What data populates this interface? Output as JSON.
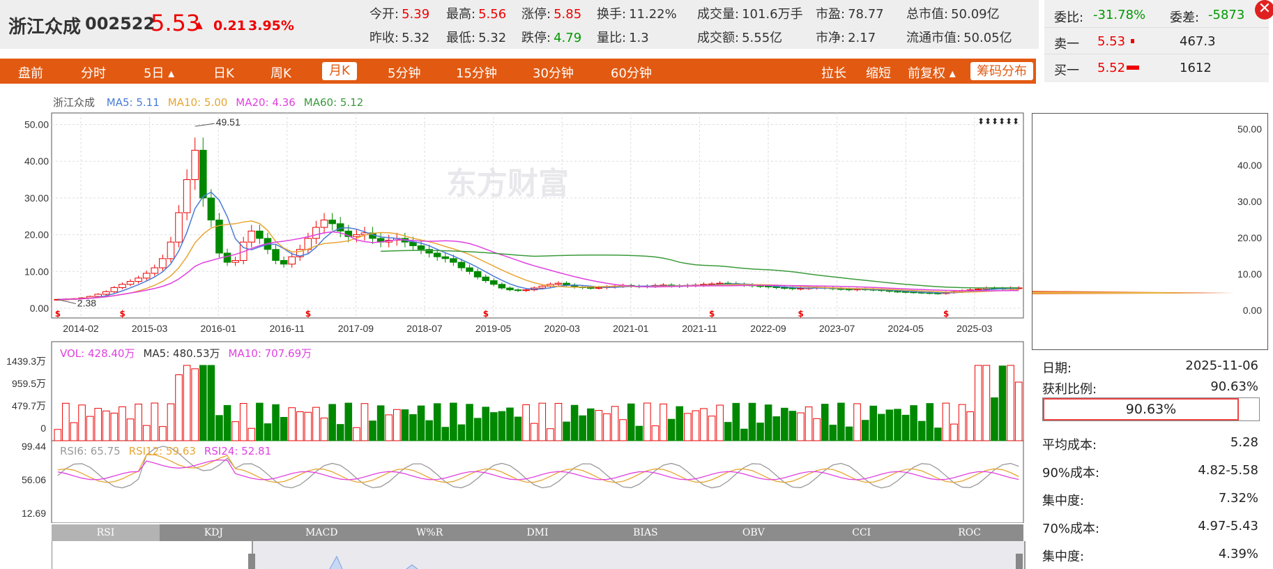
{
  "header": {
    "name": "浙江众成",
    "code": "002522",
    "price": "5.53",
    "arrow": "▲",
    "change": "0.21",
    "change_pct": "3.95%",
    "quote": [
      {
        "label": "今开:",
        "value": "5.39",
        "color": "red"
      },
      {
        "label": "最高:",
        "value": "5.56",
        "color": "red"
      },
      {
        "label": "涨停:",
        "value": "5.85",
        "color": "red"
      },
      {
        "label": "换手:",
        "value": "11.22%",
        "color": "black"
      },
      {
        "label": "成交量:",
        "value": "101.6万手",
        "color": "black"
      },
      {
        "label": "市盈:",
        "value": "78.77",
        "color": "black"
      },
      {
        "label": "总市值:",
        "value": "50.09亿",
        "color": "black"
      },
      {
        "label": "昨收:",
        "value": "5.32",
        "color": "black"
      },
      {
        "label": "最低:",
        "value": "5.32",
        "color": "black"
      },
      {
        "label": "跌停:",
        "value": "4.79",
        "color": "green"
      },
      {
        "label": "量比:",
        "value": "1.3",
        "color": "black"
      },
      {
        "label": "成交额:",
        "value": "5.55亿",
        "color": "black"
      },
      {
        "label": "市净:",
        "value": "2.17",
        "color": "black"
      },
      {
        "label": "流通市值:",
        "value": "50.05亿",
        "color": "black"
      }
    ]
  },
  "order_book": {
    "weibi_label": "委比:",
    "weibi_value": "-31.78%",
    "weicha_label": "委差:",
    "weicha_value": "-5873",
    "ask_label": "卖一",
    "ask_price": "5.53",
    "ask_volume": "467.3",
    "bid_label": "买一",
    "bid_price": "5.52",
    "bid_volume": "1612"
  },
  "toolbar": {
    "tabs": [
      "盘前",
      "分时",
      "5日 ▴",
      "日K",
      "周K",
      "月K",
      "5分钟",
      "15分钟",
      "30分钟",
      "60分钟"
    ],
    "active_tab": "月K",
    "right": [
      "拉长",
      "缩短",
      "前复权 ▴",
      "筹码分布"
    ]
  },
  "chart_data": {
    "type": "candlestick",
    "title": "浙江众成",
    "watermark": "东方财富",
    "period": "monthly",
    "ma_legend": [
      {
        "label": "MA5: 5.11",
        "color": "#4a7bd6"
      },
      {
        "label": "MA10: 5.00",
        "color": "#e8a532"
      },
      {
        "label": "MA20: 4.36",
        "color": "#e040e0"
      },
      {
        "label": "MA60: 5.12",
        "color": "#3a9a3a"
      }
    ],
    "price_ticks": [
      "50.00",
      "40.00",
      "30.00",
      "20.00",
      "10.00",
      "0.00"
    ],
    "ylim": [
      0,
      52
    ],
    "x_ticks": [
      "2014-02",
      "2015-03",
      "2016-01",
      "2016-11",
      "2017-09",
      "2018-07",
      "2019-05",
      "2020-03",
      "2021-01",
      "2021-11",
      "2022-09",
      "2023-07",
      "2024-05",
      "2025-03"
    ],
    "annotations": {
      "high": "49.51",
      "low": "2.38"
    },
    "close_series": [
      2.4,
      2.5,
      2.6,
      2.8,
      3.2,
      3.8,
      4.5,
      5.6,
      6.5,
      7.3,
      8.2,
      9.5,
      11,
      13.5,
      18,
      26,
      35,
      43,
      30,
      24,
      15,
      12.5,
      13,
      18,
      21,
      19,
      16,
      13,
      12,
      14,
      16,
      19,
      22,
      24,
      23,
      21,
      19.5,
      20,
      20.5,
      19,
      18,
      18.5,
      19,
      18,
      17,
      16,
      15,
      14,
      13.5,
      12.5,
      11,
      10,
      8.5,
      7.5,
      6.5,
      5.5,
      5,
      4.8,
      5,
      5.5,
      6,
      6.5,
      6.8,
      6.3,
      5.8,
      5.6,
      5.5,
      5.6,
      5.8,
      6,
      6.2,
      6,
      5.9,
      6,
      6.2,
      6.3,
      6.1,
      6,
      6.2,
      6.3,
      6.5,
      6.6,
      6.8,
      6.7,
      6.5,
      6.3,
      6.1,
      6,
      5.8,
      5.6,
      5.5,
      5.3,
      5.4,
      5.5,
      5.6,
      5.5,
      5.3,
      5.2,
      5,
      5.2,
      5.1,
      5,
      4.8,
      4.6,
      4.5,
      4.4,
      4.3,
      4.2,
      4.1,
      4,
      4.3,
      4.5,
      4.8,
      5,
      5.2,
      5.5,
      5.4,
      5.3,
      5.5,
      5.53
    ],
    "volume_legend": [
      {
        "label": "VOL: 428.40万",
        "color": "#e040e0"
      },
      {
        "label": "MA5: 480.53万",
        "color": "#333"
      },
      {
        "label": "MA10: 707.69万",
        "color": "#e040e0"
      }
    ],
    "volume_ticks": [
      "1439.3万",
      "959.5万",
      "479.7万",
      "0"
    ],
    "rsi_legend": [
      {
        "label": "RSI6: 65.75",
        "color": "#999"
      },
      {
        "label": "RSI12: 59.63",
        "color": "#e8a532"
      },
      {
        "label": "RSI24: 52.81",
        "color": "#e040e0"
      }
    ],
    "rsi_ticks": [
      "99.44",
      "56.06",
      "12.69"
    ]
  },
  "indicator_tabs": [
    "RSI",
    "KDJ",
    "MACD",
    "W%R",
    "DMI",
    "BIAS",
    "OBV",
    "CCI",
    "ROC"
  ],
  "active_indicator": "RSI",
  "chip_panel": {
    "price_ticks": [
      "50.00",
      "40.00",
      "30.00",
      "20.00",
      "10.00",
      "0.00"
    ],
    "date_label": "日期:",
    "date_value": "2025-11-06",
    "profit_label": "获利比例:",
    "profit_value": "90.63%",
    "profit_ratio": 0.9063,
    "avg_cost_label": "平均成本:",
    "avg_cost_value": "5.28",
    "c90_label": "90%成本:",
    "c90_value": "4.82-5.58",
    "conc90_label": "集中度:",
    "conc90_value": "7.32%",
    "c70_label": "70%成本:",
    "c70_value": "4.97-5.43",
    "conc70_label": "集中度:",
    "conc70_value": "4.39%"
  }
}
